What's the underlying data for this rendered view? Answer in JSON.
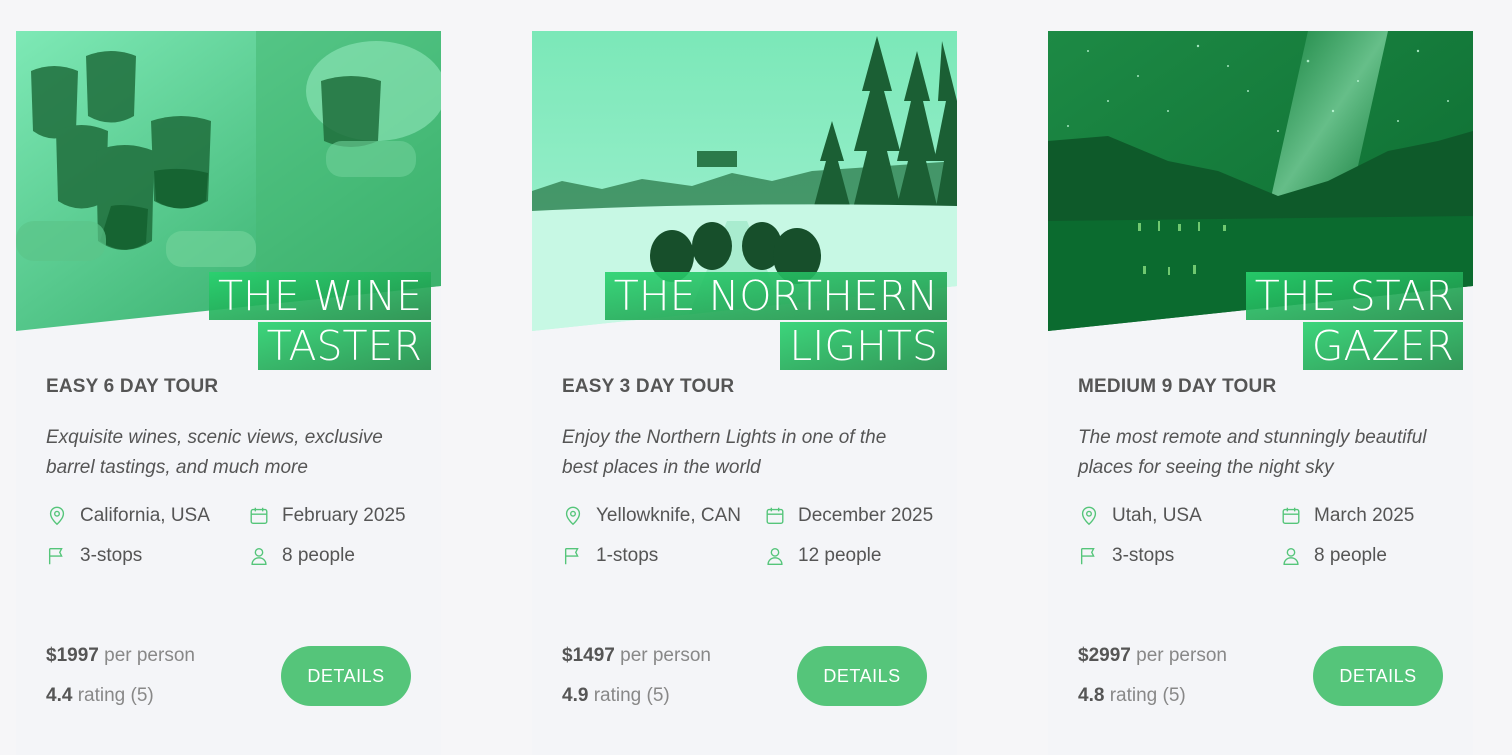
{
  "tours": [
    {
      "title_line1": "THE WINE",
      "title_line2": "TASTER",
      "subtitle": "EASY 6 DAY TOUR",
      "description": "Exquisite wines, scenic views, exclusive barrel tastings, and much more",
      "location": "California, USA",
      "date": "February 2025",
      "stops": "3-stops",
      "people": "8 people",
      "price": "$1997",
      "price_suffix": "per person",
      "rating": "4.4",
      "rating_suffix": "rating (5)",
      "button_label": "DETAILS",
      "image_theme": "wine-glasses-toast"
    },
    {
      "title_line1": "THE NORTHERN",
      "title_line2": "LIGHTS",
      "subtitle": "EASY 3 DAY TOUR",
      "description": "Enjoy the Northern Lights in one of the best places in the world",
      "location": "Yellowknife, CAN",
      "date": "December 2025",
      "stops": "1-stops",
      "people": "12 people",
      "price": "$1497",
      "price_suffix": "per person",
      "rating": "4.9",
      "rating_suffix": "rating (5)",
      "button_label": "DETAILS",
      "image_theme": "dog-sled-snow"
    },
    {
      "title_line1": "THE STAR",
      "title_line2": "GAZER",
      "subtitle": "MEDIUM 9 DAY TOUR",
      "description": "The most remote and stunningly beautiful places for seeing the night sky",
      "location": "Utah, USA",
      "date": "March 2025",
      "stops": "3-stops",
      "people": "8 people",
      "price": "$2997",
      "price_suffix": "per person",
      "rating": "4.8",
      "rating_suffix": "rating (5)",
      "button_label": "DETAILS",
      "image_theme": "night-sky-mountains"
    }
  ],
  "icons": {
    "location": "map-pin-icon",
    "date": "calendar-icon",
    "stops": "flag-icon",
    "people": "user-icon"
  },
  "colors": {
    "accent": "#55c57a",
    "overlay_light": "#7ef9ff",
    "overlay_dark": "#28b485",
    "text": "#555555",
    "muted": "#888888",
    "background": "#f4f5f8"
  }
}
